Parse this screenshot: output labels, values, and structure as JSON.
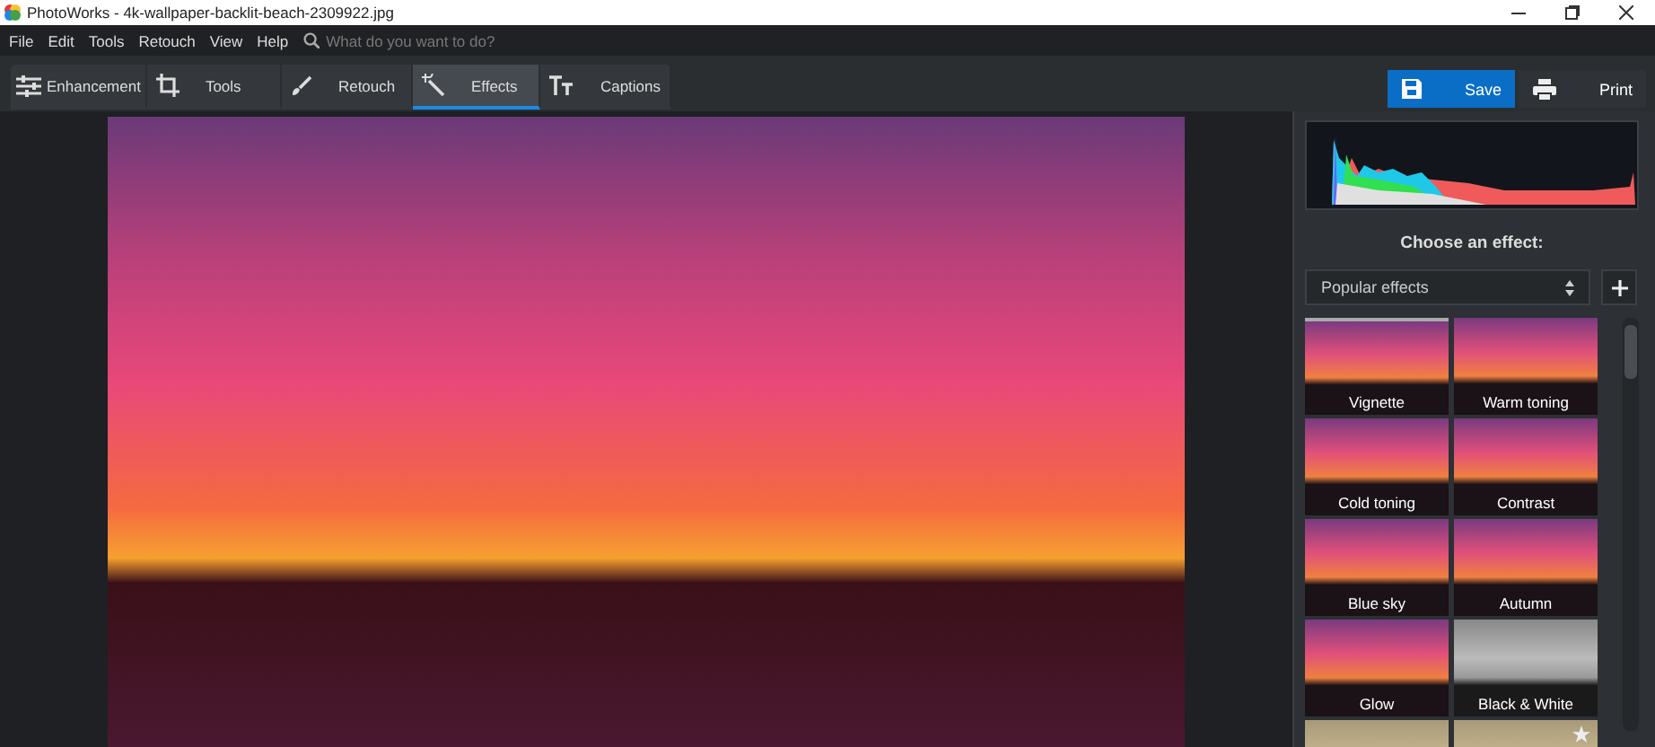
{
  "window": {
    "title": "PhotoWorks - 4k-wallpaper-backlit-beach-2309922.jpg"
  },
  "menu": [
    "File",
    "Edit",
    "Tools",
    "Retouch",
    "View",
    "Help"
  ],
  "search": {
    "placeholder": "What do you want to do?"
  },
  "tabs": [
    {
      "label": "Enhancement",
      "kind": "sliders",
      "selected": false
    },
    {
      "label": "Tools",
      "kind": "crop",
      "selected": false
    },
    {
      "label": "Retouch",
      "kind": "brush",
      "selected": false
    },
    {
      "label": "Effects",
      "kind": "wand",
      "selected": true
    },
    {
      "label": "Captions",
      "kind": "text",
      "selected": false
    }
  ],
  "actions": [
    {
      "label": "Save",
      "kind": "save",
      "primary": true
    },
    {
      "label": "Print",
      "kind": "print",
      "primary": false
    }
  ],
  "panel": {
    "heading": "Choose an effect:",
    "category": "Popular effects",
    "effects": [
      {
        "label": "Vignette",
        "kind": "color",
        "selected": true,
        "favorite": false
      },
      {
        "label": "Warm toning",
        "kind": "color",
        "selected": false,
        "favorite": false
      },
      {
        "label": "Cold toning",
        "kind": "color",
        "selected": false,
        "favorite": false
      },
      {
        "label": "Contrast",
        "kind": "color",
        "selected": false,
        "favorite": false
      },
      {
        "label": "Blue sky",
        "kind": "color",
        "selected": false,
        "favorite": false
      },
      {
        "label": "Autumn",
        "kind": "color",
        "selected": false,
        "favorite": false
      },
      {
        "label": "Glow",
        "kind": "color",
        "selected": false,
        "favorite": false
      },
      {
        "label": "Black & White",
        "kind": "gray",
        "selected": false,
        "favorite": false
      },
      {
        "kind": "sepia",
        "selected": false,
        "favorite": false
      },
      {
        "kind": "sepia",
        "selected": false,
        "favorite": true
      }
    ]
  }
}
